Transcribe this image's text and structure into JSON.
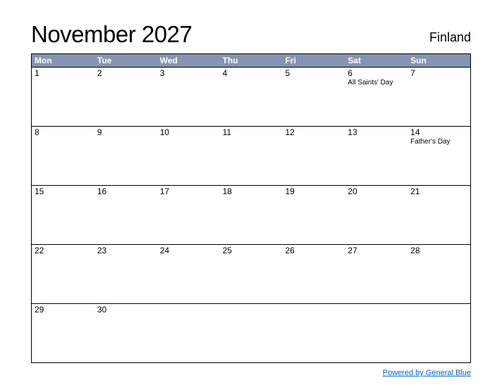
{
  "header": {
    "title": "November 2027",
    "region": "Finland"
  },
  "weekdays": [
    "Mon",
    "Tue",
    "Wed",
    "Thu",
    "Fri",
    "Sat",
    "Sun"
  ],
  "weeks": [
    [
      {
        "day": "1",
        "event": null
      },
      {
        "day": "2",
        "event": null
      },
      {
        "day": "3",
        "event": null
      },
      {
        "day": "4",
        "event": null
      },
      {
        "day": "5",
        "event": null
      },
      {
        "day": "6",
        "event": "All Saints' Day"
      },
      {
        "day": "7",
        "event": null
      }
    ],
    [
      {
        "day": "8",
        "event": null
      },
      {
        "day": "9",
        "event": null
      },
      {
        "day": "10",
        "event": null
      },
      {
        "day": "11",
        "event": null
      },
      {
        "day": "12",
        "event": null
      },
      {
        "day": "13",
        "event": null
      },
      {
        "day": "14",
        "event": "Father's Day"
      }
    ],
    [
      {
        "day": "15",
        "event": null
      },
      {
        "day": "16",
        "event": null
      },
      {
        "day": "17",
        "event": null
      },
      {
        "day": "18",
        "event": null
      },
      {
        "day": "19",
        "event": null
      },
      {
        "day": "20",
        "event": null
      },
      {
        "day": "21",
        "event": null
      }
    ],
    [
      {
        "day": "22",
        "event": null
      },
      {
        "day": "23",
        "event": null
      },
      {
        "day": "24",
        "event": null
      },
      {
        "day": "25",
        "event": null
      },
      {
        "day": "26",
        "event": null
      },
      {
        "day": "27",
        "event": null
      },
      {
        "day": "28",
        "event": null
      }
    ],
    [
      {
        "day": "29",
        "event": null
      },
      {
        "day": "30",
        "event": null
      },
      {
        "day": "",
        "event": null
      },
      {
        "day": "",
        "event": null
      },
      {
        "day": "",
        "event": null
      },
      {
        "day": "",
        "event": null
      },
      {
        "day": "",
        "event": null
      }
    ]
  ],
  "footer": {
    "link_text": "Powered by General Blue"
  }
}
